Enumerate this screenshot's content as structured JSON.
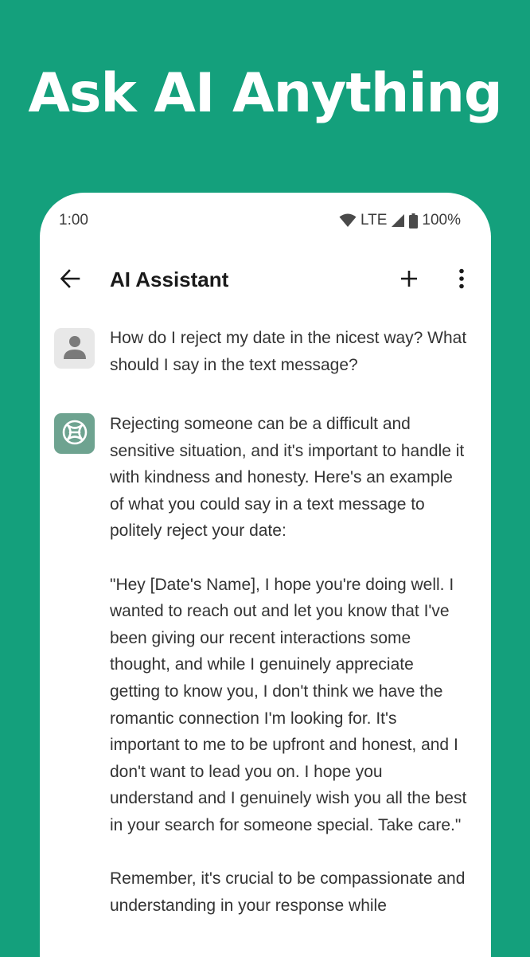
{
  "headline": "Ask AI Anything",
  "status_bar": {
    "time": "1:00",
    "network": "LTE",
    "battery": "100%"
  },
  "app_bar": {
    "title": "AI Assistant",
    "icons": {
      "back": "arrow-left-icon",
      "add": "plus-icon",
      "more": "more-vertical-icon"
    }
  },
  "messages": [
    {
      "role": "user",
      "avatar_icon": "person-icon",
      "text": "How do I reject my date in the nicest way? What should I say in the text message?"
    },
    {
      "role": "assistant",
      "avatar_icon": "ai-logo-icon",
      "text": "Rejecting someone can be a difficult and sensitive situation, and it's important to handle it with kindness and honesty. Here's an example of what you could say in a text message to politely reject your date:\n\n\"Hey [Date's Name], I hope you're doing well. I wanted to reach out and let you know that I've been giving our recent interactions some thought, and while I genuinely appreciate getting to know you, I don't think we have the romantic connection I'm looking for. It's important to me to be upfront and honest, and I don't want to lead you on. I hope you understand and I genuinely wish you all the best in your search for someone special. Take care.\"\n\nRemember, it's crucial to be compassionate and understanding in your response while"
    }
  ],
  "colors": {
    "background": "#14a07c",
    "bot_avatar": "#6ea390",
    "user_avatar": "#e8e8e8"
  }
}
